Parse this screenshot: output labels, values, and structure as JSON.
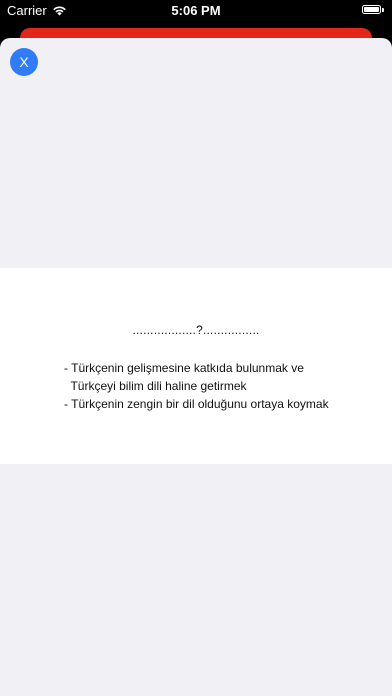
{
  "status_bar": {
    "carrier": "Carrier",
    "time": "5:06 PM",
    "battery_level": 1.0
  },
  "colors": {
    "underlay_accent": "#e2271a",
    "close_button": "#2f7cf6",
    "sheet_background": "#f1f0f5",
    "card_background": "#ffffff"
  },
  "sheet": {
    "close_label": "X"
  },
  "question": {
    "title": "..................?................",
    "lines": [
      "- Türkçenin gelişmesine katkıda bulunmak ve",
      "  Türkçeyi bilim dili haline getirmek",
      "- Türkçenin zengin bir dil olduğunu ortaya koymak"
    ]
  }
}
